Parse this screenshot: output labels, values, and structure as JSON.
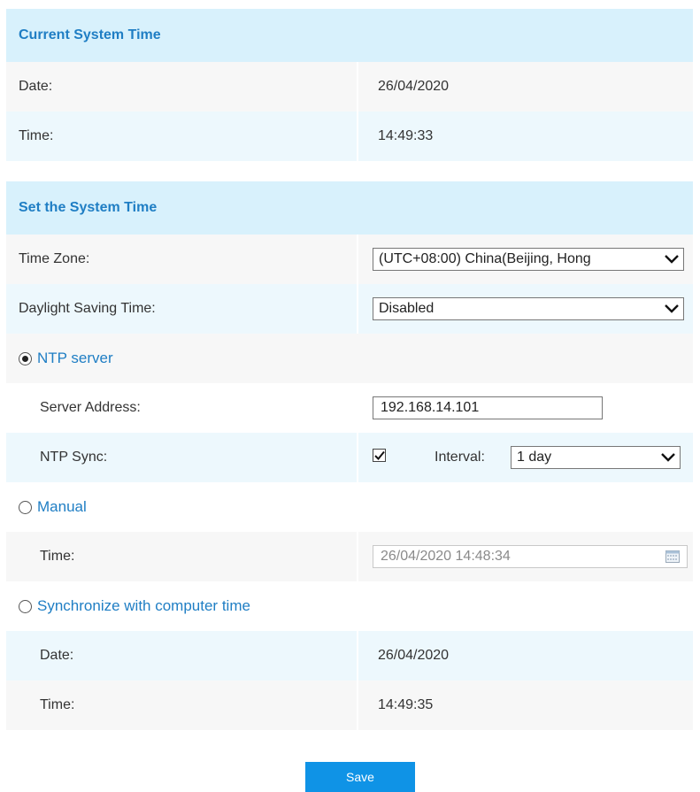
{
  "current": {
    "title": "Current System Time",
    "date_label": "Date:",
    "date_value": "26/04/2020",
    "time_label": "Time:",
    "time_value": "14:49:33"
  },
  "set": {
    "title": "Set the System Time",
    "timezone_label": "Time Zone:",
    "timezone_value": "(UTC+08:00) China(Beijing, Hong",
    "dst_label": "Daylight Saving Time:",
    "dst_value": "Disabled",
    "ntp": {
      "option_label": "NTP server",
      "selected": true,
      "server_label": "Server Address:",
      "server_value": "192.168.14.101",
      "sync_label": "NTP Sync:",
      "sync_checked": true,
      "interval_label": "Interval:",
      "interval_value": "1 day"
    },
    "manual": {
      "option_label": "Manual",
      "selected": false,
      "time_label": "Time:",
      "time_value": "26/04/2020 14:48:34"
    },
    "sync_computer": {
      "option_label": "Synchronize with computer time",
      "selected": false,
      "date_label": "Date:",
      "date_value": "26/04/2020",
      "time_label": "Time:",
      "time_value": "14:49:35"
    }
  },
  "save_label": "Save",
  "icons": {
    "dropdown": "chevron-down-icon",
    "checkbox": "checkmark-icon",
    "calendar": "calendar-icon"
  },
  "colors": {
    "header_bg": "#d8f1fc",
    "accent_text": "#1f7ec4",
    "save_button": "#0f93e6"
  }
}
